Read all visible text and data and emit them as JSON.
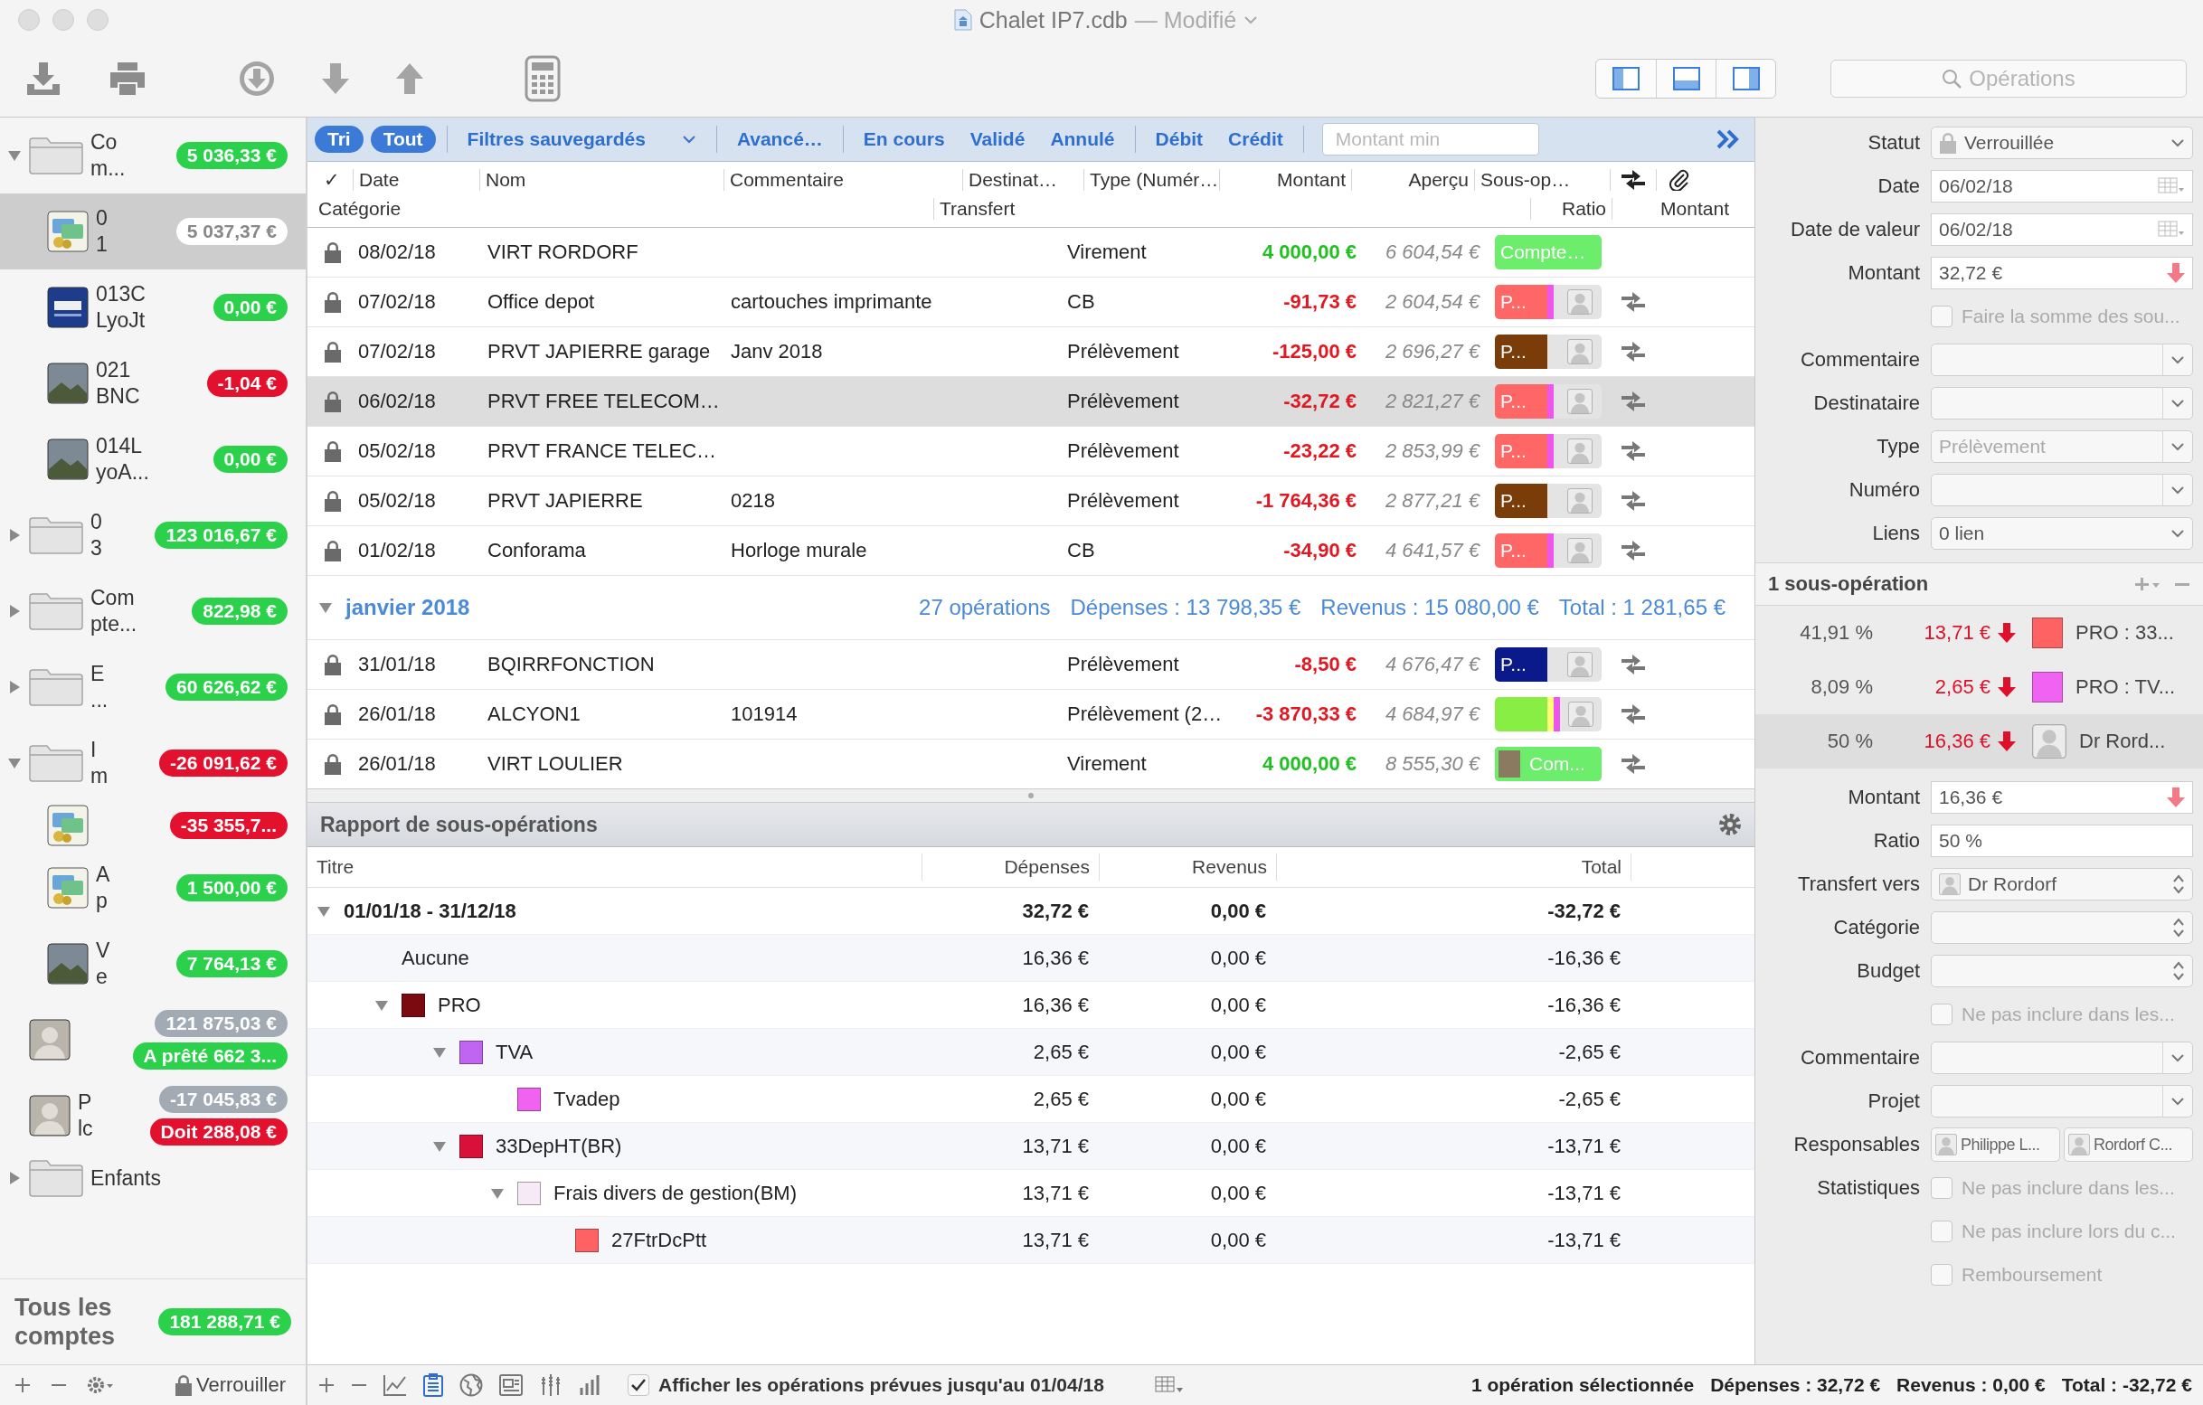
{
  "window": {
    "title": "Chalet IP7.cdb",
    "state": "— Modifié"
  },
  "toolbar": {
    "layout": [
      {
        "selected": true
      },
      {
        "selected": true
      },
      {
        "selected": true
      }
    ],
    "search": {
      "placeholder": "Opérations"
    }
  },
  "sidebar": {
    "accounts": [
      {
        "kind": "folder",
        "name_lines": [
          "Co",
          "m..."
        ],
        "badges": [
          {
            "text": "5 036,33 €",
            "kind": "positive"
          }
        ],
        "expanded": true,
        "selected": false,
        "children": [
          {
            "kind": "card",
            "name_lines": [
              "0",
              "1"
            ],
            "badges": [
              {
                "text": "5 037,37 €",
                "kind": "selected"
              }
            ],
            "selected": true
          },
          {
            "kind": "bank",
            "name_lines": [
              "013C",
              "LyoJt"
            ],
            "badges": [
              {
                "text": "0,00 €",
                "kind": "positive"
              }
            ],
            "selected": false
          },
          {
            "kind": "photo",
            "name_lines": [
              "021",
              "BNC"
            ],
            "badges": [
              {
                "text": "-1,04 €",
                "kind": "negative"
              }
            ],
            "selected": false
          },
          {
            "kind": "photo",
            "name_lines": [
              "014L",
              "yoA..."
            ],
            "badges": [
              {
                "text": "0,00 €",
                "kind": "positive"
              }
            ],
            "selected": false
          }
        ]
      },
      {
        "kind": "folder",
        "name_lines": [
          "0",
          "3"
        ],
        "badges": [
          {
            "text": "123 016,67 €",
            "kind": "positive"
          }
        ],
        "expanded": false,
        "selected": false
      },
      {
        "kind": "folder",
        "name_lines": [
          "Com",
          "pte..."
        ],
        "badges": [
          {
            "text": "822,98 €",
            "kind": "positive"
          }
        ],
        "expanded": false,
        "selected": false
      },
      {
        "kind": "folder",
        "name_lines": [
          "E",
          "..."
        ],
        "badges": [
          {
            "text": "60 626,62 €",
            "kind": "positive"
          }
        ],
        "expanded": false,
        "selected": false
      },
      {
        "kind": "folder",
        "name_lines": [
          "I",
          "m"
        ],
        "badges": [
          {
            "text": "-26 091,62 €",
            "kind": "negative"
          }
        ],
        "expanded": true,
        "selected": false,
        "children": [
          {
            "kind": "card",
            "badges": [
              {
                "text": "-35 355,7...",
                "kind": "negative"
              }
            ],
            "selected": false
          },
          {
            "kind": "card",
            "name_lines": [
              "A",
              "p"
            ],
            "badges": [
              {
                "text": "1 500,00 €",
                "kind": "positive"
              }
            ],
            "selected": false
          },
          {
            "kind": "photo",
            "name_lines": [
              "V",
              "e"
            ],
            "badges": [
              {
                "text": "7 764,13 €",
                "kind": "positive"
              }
            ],
            "selected": false
          }
        ]
      },
      {
        "kind": "person",
        "badges": [
          {
            "text": "121 875,03 €",
            "kind": "neutral"
          },
          {
            "text": "A prêté 662 3...",
            "kind": "positive"
          }
        ],
        "selected": false
      },
      {
        "kind": "person",
        "name_lines": [
          "P",
          "lc"
        ],
        "badges": [
          {
            "text": "-17 045,83 €",
            "kind": "neutral"
          },
          {
            "text": "Doit 288,08 €",
            "kind": "negative"
          }
        ],
        "selected": false
      },
      {
        "kind": "folder",
        "name_lines": [
          "Enfants"
        ],
        "expanded": false,
        "selected": false
      }
    ],
    "total": {
      "label": "Tous les comptes",
      "amount": "181 288,71 €",
      "kind": "positive"
    },
    "lock_label": "Verrouiller"
  },
  "filter_bar": {
    "toggles": [
      {
        "label": "Tri",
        "selected": true
      },
      {
        "label": "Tout",
        "selected": true
      }
    ],
    "saved_filters": "Filtres sauvegardés",
    "filters": [
      {
        "label": "Avancé…",
        "selected": false
      },
      {
        "label": "En cours",
        "selected": false
      },
      {
        "label": "Validé",
        "selected": false
      },
      {
        "label": "Annulé",
        "selected": false
      },
      {
        "label": "Débit",
        "selected": false
      },
      {
        "label": "Crédit",
        "selected": false
      }
    ],
    "amount_min": {
      "placeholder": "Montant min"
    }
  },
  "table": {
    "columns_row1": [
      "✓",
      "Date",
      "Nom",
      "Commentaire",
      "Destinat…",
      "Type (Numér…",
      "Montant",
      "Aperçu",
      "Sous-op…"
    ],
    "columns_row2": [
      "Catégorie",
      "Transfert",
      "Ratio",
      "Montant"
    ],
    "groups": [
      {
        "rows": [
          {
            "locked": true,
            "date": "08/02/18",
            "name": "VIRT RORDORF",
            "type": "Virement",
            "amount": "4 000,00 €",
            "kind": "positive",
            "balance": "6 604,54 €",
            "tag": {
              "text": "Compte…",
              "color": "#6cee6c",
              "avatar": false
            },
            "transfer": false,
            "selected": false
          },
          {
            "locked": true,
            "date": "07/02/18",
            "name": "Office depot",
            "comment": "cartouches imprimante",
            "type": "CB",
            "amount": "-91,73 €",
            "kind": "negative",
            "balance": "2 604,54 €",
            "tag": {
              "text": "P...",
              "color": "#ff6666",
              "stripes": [
                {
                  "color": "#ee55ee"
                }
              ],
              "avatar": true
            },
            "transfer": true,
            "selected": false
          },
          {
            "locked": true,
            "date": "07/02/18",
            "name": "PRVT JAPIERRE garage",
            "comment": "Janv 2018",
            "type": "Prélèvement",
            "amount": "-125,00 €",
            "kind": "negative",
            "balance": "2 696,27 €",
            "tag": {
              "text": "P...",
              "color": "#7a3d0a",
              "avatar": true
            },
            "transfer": true,
            "selected": false
          },
          {
            "locked": true,
            "date": "06/02/18",
            "name": "PRVT FREE TELECOM…",
            "type": "Prélèvement",
            "amount": "-32,72 €",
            "kind": "negative",
            "balance": "2 821,27 €",
            "tag": {
              "text": "P...",
              "color": "#ff6666",
              "stripes": [
                {
                  "color": "#ee55ee"
                }
              ],
              "avatar": true
            },
            "transfer": true,
            "selected": true
          },
          {
            "locked": true,
            "date": "05/02/18",
            "name": "PRVT FRANCE TELEC…",
            "type": "Prélèvement",
            "amount": "-23,22 €",
            "kind": "negative",
            "balance": "2 853,99 €",
            "tag": {
              "text": "P...",
              "color": "#ff6666",
              "stripes": [
                {
                  "color": "#ee55ee"
                }
              ],
              "avatar": true
            },
            "transfer": true,
            "selected": false
          },
          {
            "locked": true,
            "date": "05/02/18",
            "name": "PRVT JAPIERRE",
            "comment": "0218",
            "type": "Prélèvement",
            "amount": "-1 764,36 €",
            "kind": "negative",
            "balance": "2 877,21 €",
            "tag": {
              "text": "P...",
              "color": "#7a3d0a",
              "avatar": true
            },
            "transfer": true,
            "selected": false
          },
          {
            "locked": true,
            "date": "01/02/18",
            "name": "Conforama",
            "comment": "Horloge murale",
            "type": "CB",
            "amount": "-34,90 €",
            "kind": "negative",
            "balance": "4 641,57 €",
            "tag": {
              "text": "P...",
              "color": "#ff6666",
              "stripes": [
                {
                  "color": "#ee55ee"
                }
              ],
              "avatar": true
            },
            "transfer": true,
            "selected": false
          }
        ]
      },
      {
        "header": {
          "title": "janvier 2018",
          "expanded": true,
          "summary": [
            "27 opérations",
            "Dépenses : 13 798,35 €",
            "Revenus : 15 080,00 €",
            "Total : 1 281,65 €"
          ]
        },
        "rows": [
          {
            "locked": true,
            "date": "31/01/18",
            "name": "BQIRRFONCTION",
            "type": "Prélèvement",
            "amount": "-8,50 €",
            "kind": "negative",
            "balance": "4 676,47 €",
            "tag": {
              "text": "P...",
              "color": "#0a1a8a",
              "avatar": true
            },
            "transfer": true,
            "selected": false
          },
          {
            "locked": true,
            "date": "26/01/18",
            "name": "ALCYON1",
            "comment": "101914",
            "type": "Prélèvement (2…",
            "amount": "-3 870,33 €",
            "kind": "negative",
            "balance": "4 684,97 €",
            "tag": {
              "color": "#88ee44",
              "stripes": [
                {
                  "color": "#ffff77"
                },
                {
                  "color": "#ee55ee"
                }
              ],
              "avatar": true
            },
            "transfer": true,
            "selected": false
          },
          {
            "locked": true,
            "date": "26/01/18",
            "name": "VIRT LOULIER",
            "type": "Virement",
            "amount": "4 000,00 €",
            "kind": "positive",
            "balance": "8 555,30 €",
            "tag": {
              "text": "Com...",
              "color": "#6cee6c",
              "avatar": false,
              "thumbnail": true
            },
            "transfer": true,
            "selected": false
          }
        ]
      }
    ]
  },
  "report": {
    "title": "Rapport de sous-opérations",
    "columns": [
      "Titre",
      "Dépenses",
      "Revenus",
      "Total"
    ],
    "rows": [
      {
        "title": "01/01/18 - 31/12/18",
        "expenses": "32,72 €",
        "income": "0,00 €",
        "total": "-32,72 €",
        "expanded": true,
        "children": [
          {
            "title": "Aucune",
            "expenses": "16,36 €",
            "income": "0,00 €",
            "total": "-16,36 €"
          },
          {
            "title": "PRO",
            "color": "#7a0a10",
            "expenses": "16,36 €",
            "income": "0,00 €",
            "total": "-16,36 €",
            "expanded": true,
            "children": [
              {
                "title": "TVA",
                "color": "#c064f2",
                "expenses": "2,65 €",
                "income": "0,00 €",
                "total": "-2,65 €",
                "expanded": true,
                "children": [
                  {
                    "title": "Tvadep",
                    "color": "#f262f2",
                    "expenses": "2,65 €",
                    "income": "0,00 €",
                    "total": "-2,65 €"
                  }
                ]
              },
              {
                "title": "33DepHT(BR)",
                "color": "#d8103a",
                "expenses": "13,71 €",
                "income": "0,00 €",
                "total": "-13,71 €",
                "expanded": true,
                "children": [
                  {
                    "title": "Frais divers de gestion(BM)",
                    "color": "#f6eaf6",
                    "expenses": "13,71 €",
                    "income": "0,00 €",
                    "total": "-13,71 €",
                    "expanded": true,
                    "children": [
                      {
                        "title": "27FtrDcPtt",
                        "color": "#ff6262",
                        "expenses": "13,71 €",
                        "income": "0,00 €",
                        "total": "-13,71 €"
                      }
                    ]
                  }
                ]
              }
            ]
          }
        ]
      }
    ]
  },
  "inspector": {
    "fields": [
      {
        "label": "Statut",
        "kind": "popup",
        "value": "Verrouillée",
        "locked": true
      },
      {
        "label": "Date",
        "kind": "date",
        "value": "06/02/18"
      },
      {
        "label": "Date de valeur",
        "kind": "date",
        "value": "06/02/18"
      },
      {
        "label": "Montant",
        "kind": "amount",
        "value": "32,72 €"
      },
      {
        "kind": "checkbox",
        "text": "Faire la somme des sou...",
        "checked": false
      },
      {
        "label": "Commentaire",
        "kind": "combo"
      },
      {
        "label": "Destinataire",
        "kind": "combo"
      },
      {
        "label": "Type",
        "kind": "combo",
        "placeholder": "Prélèvement"
      },
      {
        "label": "Numéro",
        "kind": "combo"
      },
      {
        "label": "Liens",
        "kind": "popup",
        "value": "0 lien"
      }
    ],
    "split_title": "1 sous-opération",
    "splits": [
      {
        "kind": "category",
        "percent": "41,91 %",
        "amount": "13,71 €",
        "color": "#ff6262",
        "label": "PRO : 33...",
        "selected": false
      },
      {
        "kind": "category",
        "percent": "8,09 %",
        "amount": "2,65 €",
        "color": "#f262f2",
        "label": "PRO : TV...",
        "selected": false
      },
      {
        "kind": "person",
        "percent": "50 %",
        "amount": "16,36 €",
        "label": "Dr Rord...",
        "selected": true
      }
    ],
    "split_fields": [
      {
        "label": "Montant",
        "kind": "amount",
        "value": "16,36 €"
      },
      {
        "label": "Ratio",
        "kind": "text",
        "value": "50 %"
      },
      {
        "label": "Transfert vers",
        "kind": "person_stepper",
        "value": "Dr Rordorf"
      },
      {
        "label": "Catégorie",
        "kind": "stepper"
      },
      {
        "label": "Budget",
        "kind": "stepper"
      },
      {
        "kind": "checkbox",
        "text": "Ne pas inclure dans les...",
        "checked": false
      },
      {
        "label": "Commentaire",
        "kind": "combo"
      },
      {
        "label": "Projet",
        "kind": "combo"
      },
      {
        "label": "Responsables",
        "kind": "tokens",
        "tokens": [
          "Philippe L...",
          "Rordorf C..."
        ]
      },
      {
        "label": "Statistiques",
        "kind": "checkbox",
        "text": "Ne pas inclure dans les...",
        "checked": false
      },
      {
        "kind": "checkbox",
        "text": "Ne pas inclure lors du c...",
        "checked": false
      },
      {
        "kind": "checkbox",
        "text": "Remboursement",
        "checked": false
      }
    ]
  },
  "status_bar": {
    "show_planned": {
      "label": "Afficher les opérations prévues jusqu'au 01/04/18",
      "checked": true
    },
    "texts": [
      "1 opération sélectionnée",
      "Dépenses : 32,72 €",
      "Revenus : 0,00 €",
      "Total : -32,72 €"
    ]
  }
}
